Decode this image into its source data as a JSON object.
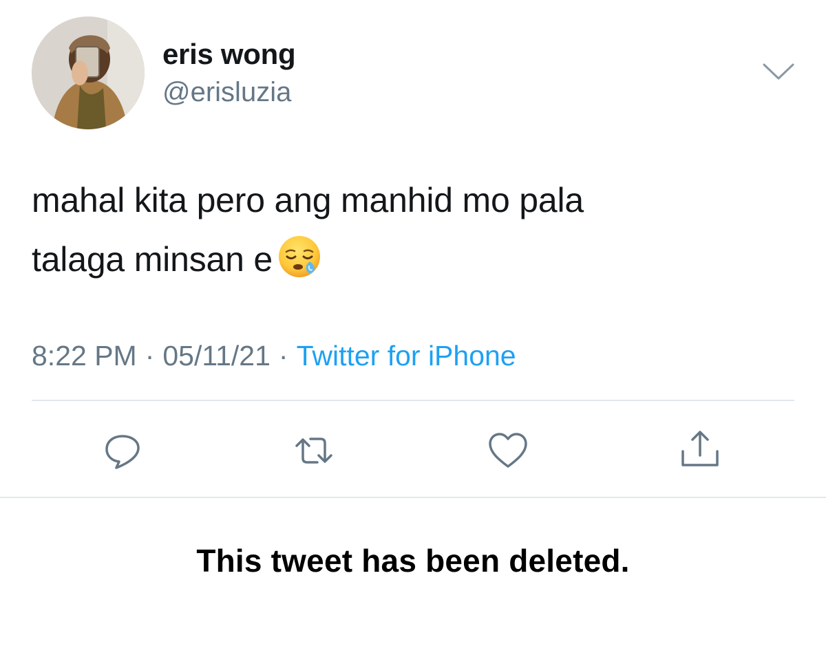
{
  "tweet": {
    "author": {
      "display_name": "eris wong",
      "handle": "@erisluzia",
      "avatar_icon": "profile-photo"
    },
    "text_line1": "mahal kita pero ang manhid mo pala",
    "text_line2": "talaga minsan e",
    "emoji": "sleepy-face-emoji",
    "time": "8:22 PM",
    "date": "05/11/21",
    "separator": "·",
    "source": "Twitter for iPhone",
    "menu_icon": "chevron-down-icon",
    "actions": [
      {
        "icon": "reply-icon"
      },
      {
        "icon": "retweet-icon"
      },
      {
        "icon": "like-icon"
      },
      {
        "icon": "share-icon"
      }
    ]
  },
  "caption": "This tweet has been deleted.",
  "colors": {
    "text_primary": "#14171a",
    "text_secondary": "#657786",
    "link": "#1da1f2",
    "divider": "#e1e8ed"
  }
}
